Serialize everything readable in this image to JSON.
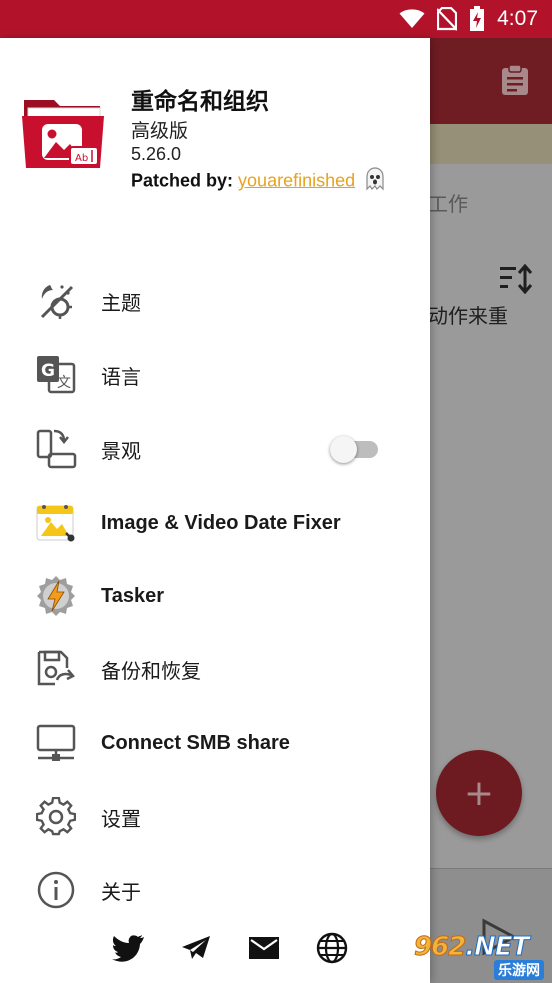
{
  "status_bar": {
    "time": "4:07",
    "icons": [
      "wifi-icon",
      "no-sim-icon",
      "battery-charging-icon"
    ]
  },
  "drawer": {
    "header": {
      "app_name": "重命名和组织",
      "edition": "高级版",
      "version": "5.26.0",
      "patched_label": "Patched by:",
      "patched_by": "youarefinished",
      "ghost_emoji": "👻"
    },
    "menu": [
      {
        "label": "主题",
        "icon": "theme-icon"
      },
      {
        "label": "语言",
        "icon": "translate-icon"
      },
      {
        "label": "景观",
        "icon": "screen-rotation-icon",
        "toggle": false
      },
      {
        "label": "Image & Video Date Fixer",
        "icon": "date-fixer-app-icon"
      },
      {
        "label": "Tasker",
        "icon": "tasker-app-icon"
      },
      {
        "label": "备份和恢复",
        "icon": "backup-restore-icon"
      },
      {
        "label": "Connect SMB share",
        "icon": "network-share-icon"
      },
      {
        "label": "设置",
        "icon": "gear-icon"
      },
      {
        "label": "关于",
        "icon": "info-icon"
      }
    ],
    "social": [
      "twitter-icon",
      "telegram-icon",
      "mail-icon",
      "globe-icon"
    ]
  },
  "background": {
    "text1": "工作",
    "text2": "动作来重",
    "fab_symbol": "+"
  },
  "watermark": {
    "top": "962",
    "net": ".NET",
    "bottom": "乐游网"
  },
  "colors": {
    "status_bar": "#b3132a",
    "accent_link": "#e8a31e",
    "logo_red": "#c8102e"
  }
}
